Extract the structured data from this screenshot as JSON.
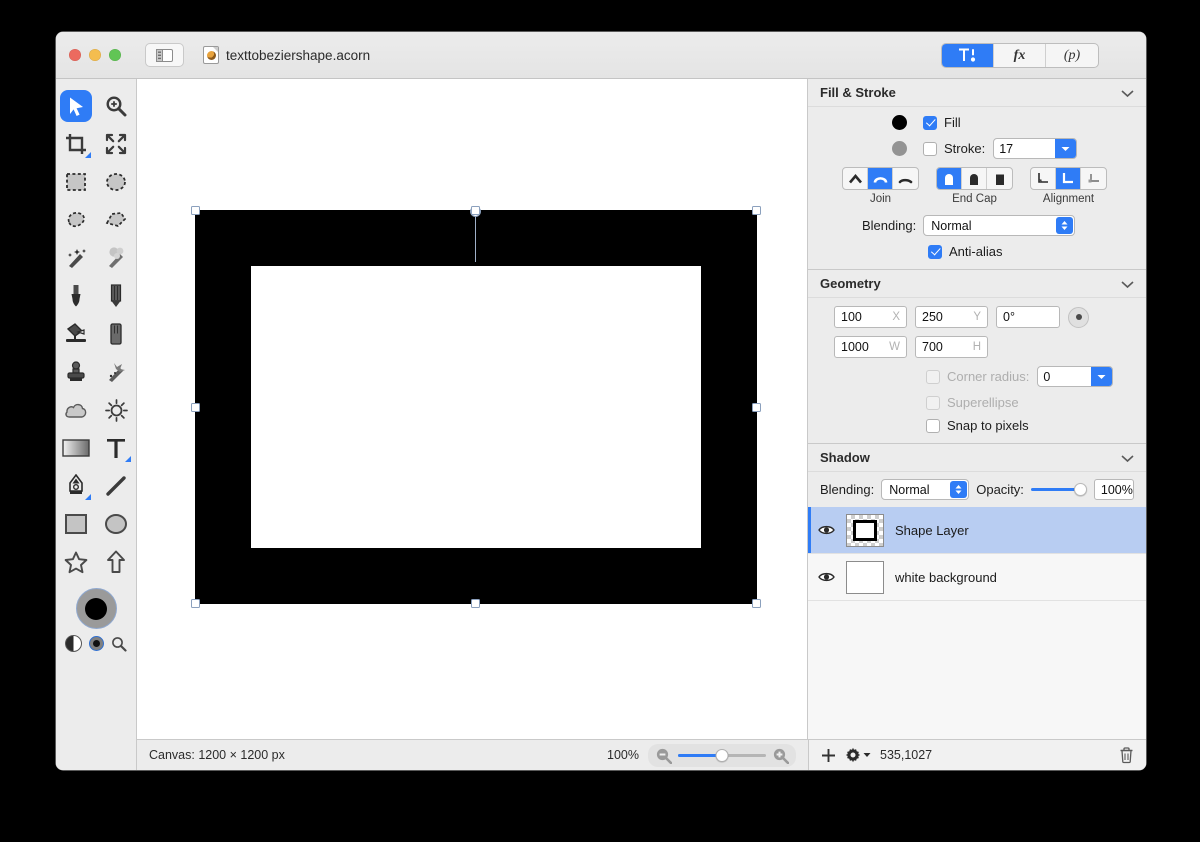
{
  "window": {
    "document_title": "texttobeziershape.acorn",
    "traffic_lights": [
      "close-button",
      "minimize-button",
      "zoom-button"
    ],
    "sidebar_toggle_icon": "sidebar-toggle-icon",
    "document_icon": "acorn-document-icon"
  },
  "toolbar": {
    "segments": [
      {
        "name": "tools-inspector-tab",
        "icon": "hammer-tool-icon",
        "label": "",
        "active": true
      },
      {
        "name": "filters-tab",
        "icon": "fx-icon",
        "label": "fx",
        "active": false
      },
      {
        "name": "presets-tab",
        "icon": "p-icon",
        "label": "(p)",
        "active": false
      }
    ]
  },
  "tools": {
    "items": [
      {
        "name": "move-tool",
        "icon": "cursor-arrow-icon",
        "active": true
      },
      {
        "name": "zoom-tool",
        "icon": "magnifier-plus-icon",
        "active": false
      },
      {
        "name": "crop-tool",
        "icon": "crop-icon",
        "active": false,
        "submenu": true
      },
      {
        "name": "transform-tool",
        "icon": "arrows-expand-icon",
        "active": false
      },
      {
        "name": "rectangle-select-tool",
        "icon": "dashed-rectangle-icon",
        "active": false
      },
      {
        "name": "ellipse-select-tool",
        "icon": "dashed-ellipse-icon",
        "active": false
      },
      {
        "name": "lasso-select-tool",
        "icon": "lasso-icon",
        "active": false
      },
      {
        "name": "polygon-select-tool",
        "icon": "polygon-lasso-icon",
        "active": false
      },
      {
        "name": "magic-wand-tool",
        "icon": "magic-wand-icon",
        "active": false
      },
      {
        "name": "magic-wand-soft-tool",
        "icon": "magic-wand-dotted-icon",
        "active": false
      },
      {
        "name": "brush-tool",
        "icon": "paintbrush-icon",
        "active": false
      },
      {
        "name": "pencil-tool",
        "icon": "pencil-icon",
        "active": false
      },
      {
        "name": "paint-bucket-tool",
        "icon": "paint-bucket-icon",
        "active": false
      },
      {
        "name": "eraser-tool",
        "icon": "eraser-icon",
        "active": false
      },
      {
        "name": "clone-stamp-tool",
        "icon": "clone-stamp-icon",
        "active": false
      },
      {
        "name": "smudge-tool",
        "icon": "smudge-icon",
        "active": false
      },
      {
        "name": "dodge-tool",
        "icon": "cloud-icon",
        "active": false
      },
      {
        "name": "burn-tool",
        "icon": "sun-icon",
        "active": false
      },
      {
        "name": "gradient-tool",
        "icon": "gradient-icon",
        "active": false
      },
      {
        "name": "text-tool",
        "icon": "text-t-icon",
        "active": false,
        "submenu": true
      },
      {
        "name": "bezier-pen-tool",
        "icon": "pen-nib-icon",
        "active": false,
        "submenu": true
      },
      {
        "name": "line-tool",
        "icon": "line-icon",
        "active": false
      },
      {
        "name": "rectangle-shape-tool",
        "icon": "rectangle-icon",
        "active": false
      },
      {
        "name": "ellipse-shape-tool",
        "icon": "ellipse-icon",
        "active": false
      },
      {
        "name": "star-shape-tool",
        "icon": "star-icon",
        "active": false
      },
      {
        "name": "arrow-shape-tool",
        "icon": "arrow-up-icon",
        "active": false
      }
    ],
    "color_well": {
      "name": "foreground-color-well",
      "fill": "#000000",
      "stroke": "#9a9a9a"
    },
    "mini_row": [
      {
        "name": "swap-colors-icon"
      },
      {
        "name": "active-color-indicator"
      },
      {
        "name": "eyedropper-icon"
      }
    ]
  },
  "canvas": {
    "selection": {
      "handles": 8,
      "rotation_handle": "rotation-handle"
    }
  },
  "fill_stroke": {
    "title": "Fill & Stroke",
    "fill": {
      "label": "Fill",
      "checked": true,
      "color": "#000000"
    },
    "stroke": {
      "label": "Stroke:",
      "checked": false,
      "color": "#939393",
      "width": "17"
    },
    "join": {
      "caption": "Join",
      "options": [
        "miter-join",
        "round-join",
        "bevel-join"
      ],
      "selected": 1
    },
    "end_cap": {
      "caption": "End Cap",
      "options": [
        "butt-cap",
        "round-cap",
        "square-cap"
      ],
      "selected": 0
    },
    "alignment": {
      "caption": "Alignment",
      "options": [
        "align-inside",
        "align-center",
        "align-outside"
      ],
      "selected": 1
    },
    "blending": {
      "label": "Blending:",
      "value": "Normal"
    },
    "anti_alias": {
      "label": "Anti-alias",
      "checked": true
    }
  },
  "geometry": {
    "title": "Geometry",
    "x": {
      "value": "100",
      "unit": "X"
    },
    "y": {
      "value": "250",
      "unit": "Y"
    },
    "rotation": {
      "value": "0°"
    },
    "w": {
      "value": "1000",
      "unit": "W"
    },
    "h": {
      "value": "700",
      "unit": "H"
    },
    "corner_radius": {
      "label": "Corner radius:",
      "checked": false,
      "disabled": true,
      "value": "0"
    },
    "superellipse": {
      "label": "Superellipse",
      "checked": false,
      "disabled": true
    },
    "snap_to_pixels": {
      "label": "Snap to pixels",
      "checked": false,
      "disabled": false
    }
  },
  "shadow": {
    "title": "Shadow",
    "blending": {
      "label": "Blending:",
      "value": "Normal"
    },
    "opacity": {
      "label": "Opacity:",
      "value": "100%"
    }
  },
  "layers": [
    {
      "name": "Shape Layer",
      "selected": true,
      "visible": true,
      "thumb": "checker-frame"
    },
    {
      "name": "white background",
      "selected": false,
      "visible": true,
      "thumb": "white"
    }
  ],
  "status": {
    "canvas_size": "Canvas: 1200 × 1200 px",
    "zoom_level": "100%",
    "zoom_out_icon": "zoom-out-icon",
    "zoom_in_icon": "zoom-in-icon",
    "add_layer_icon": "plus-icon",
    "layer_actions_icon": "gear-icon",
    "coordinates": "535,1027",
    "delete_layer_icon": "trash-icon"
  },
  "colors": {
    "accent": "#2f7cf6",
    "panel_bg": "#ececec",
    "selection_row": "#b8cdf2"
  }
}
